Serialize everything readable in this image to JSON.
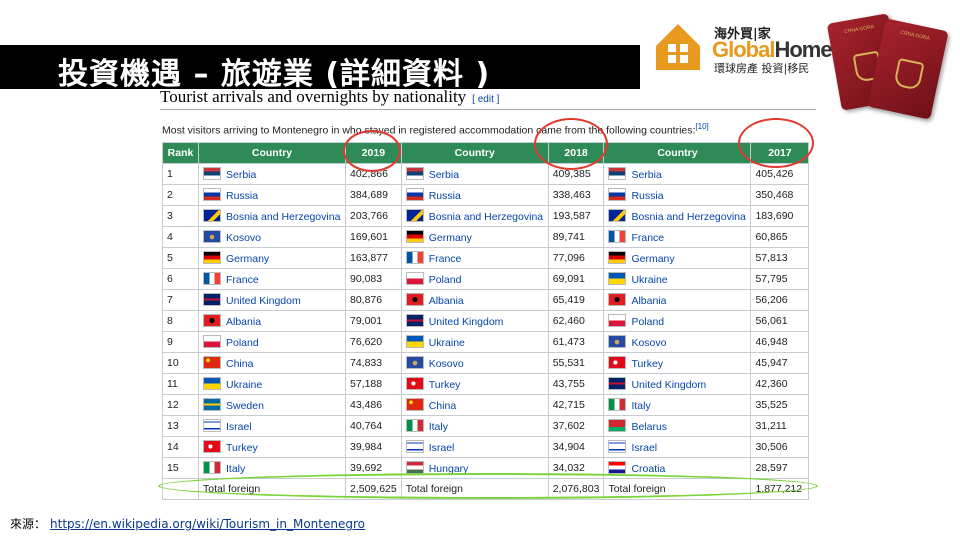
{
  "slide": {
    "title": "投資機遇 – 旅遊業 (詳細資料 )",
    "source_label": "來源：",
    "source_url": "https://en.wikipedia.org/wiki/Tourism_in_Montenegro"
  },
  "logo": {
    "top_text": "海外買|家",
    "brand_global": "Global",
    "brand_home": "Home",
    "bottom_text": "環球房產 投資|移民"
  },
  "passports": {
    "text": "CRNA GORA"
  },
  "wiki": {
    "title": "Tourist arrivals and overnights by nationality",
    "edit_label": "[ edit ]",
    "intro": "Most visitors arriving to Montenegro in who stayed in registered accommodation came from the following countries:",
    "ref": "[10]",
    "headers": [
      "Rank",
      "Country",
      "2019",
      "Country",
      "2018",
      "Country",
      "2017"
    ],
    "rows": [
      {
        "rank": "1",
        "c1": "Serbia",
        "v1": "402,866",
        "c2": "Serbia",
        "v2": "409,385",
        "c3": "Serbia",
        "v3": "405,426"
      },
      {
        "rank": "2",
        "c1": "Russia",
        "v1": "384,689",
        "c2": "Russia",
        "v2": "338,463",
        "c3": "Russia",
        "v3": "350,468"
      },
      {
        "rank": "3",
        "c1": "Bosnia and Herzegovina",
        "v1": "203,766",
        "c2": "Bosnia and Herzegovina",
        "v2": "193,587",
        "c3": "Bosnia and Herzegovina",
        "v3": "183,690"
      },
      {
        "rank": "4",
        "c1": "Kosovo",
        "v1": "169,601",
        "c2": "Germany",
        "v2": "89,741",
        "c3": "France",
        "v3": "60,865"
      },
      {
        "rank": "5",
        "c1": "Germany",
        "v1": "163,877",
        "c2": "France",
        "v2": "77,096",
        "c3": "Germany",
        "v3": "57,813"
      },
      {
        "rank": "6",
        "c1": "France",
        "v1": "90,083",
        "c2": "Poland",
        "v2": "69,091",
        "c3": "Ukraine",
        "v3": "57,795"
      },
      {
        "rank": "7",
        "c1": "United Kingdom",
        "v1": "80,876",
        "c2": "Albania",
        "v2": "65,419",
        "c3": "Albania",
        "v3": "56,206"
      },
      {
        "rank": "8",
        "c1": "Albania",
        "v1": "79,001",
        "c2": "United Kingdom",
        "v2": "62,460",
        "c3": "Poland",
        "v3": "56,061"
      },
      {
        "rank": "9",
        "c1": "Poland",
        "v1": "76,620",
        "c2": "Ukraine",
        "v2": "61,473",
        "c3": "Kosovo",
        "v3": "46,948"
      },
      {
        "rank": "10",
        "c1": "China",
        "v1": "74,833",
        "c2": "Kosovo",
        "v2": "55,531",
        "c3": "Turkey",
        "v3": "45,947"
      },
      {
        "rank": "11",
        "c1": "Ukraine",
        "v1": "57,188",
        "c2": "Turkey",
        "v2": "43,755",
        "c3": "United Kingdom",
        "v3": "42,360"
      },
      {
        "rank": "12",
        "c1": "Sweden",
        "v1": "43,486",
        "c2": "China",
        "v2": "42,715",
        "c3": "Italy",
        "v3": "35,525"
      },
      {
        "rank": "13",
        "c1": "Israel",
        "v1": "40,764",
        "c2": "Italy",
        "v2": "37,602",
        "c3": "Belarus",
        "v3": "31,211"
      },
      {
        "rank": "14",
        "c1": "Turkey",
        "v1": "39,984",
        "c2": "Israel",
        "v2": "34,904",
        "c3": "Israel",
        "v3": "30,506"
      },
      {
        "rank": "15",
        "c1": "Italy",
        "v1": "39,692",
        "c2": "Hungary",
        "v2": "34,032",
        "c3": "Croatia",
        "v3": "28,597"
      }
    ],
    "total": {
      "label1": "Total foreign",
      "v1": "2,509,625",
      "label2": "Total foreign",
      "v2": "2,076,803",
      "label3": "Total foreign",
      "v3": "1,877,212"
    }
  },
  "colors": {
    "header_green": "#2e8b57",
    "highlight_red": "#e03a2e",
    "highlight_green": "#7bd43b",
    "link_blue": "#0645ad"
  }
}
